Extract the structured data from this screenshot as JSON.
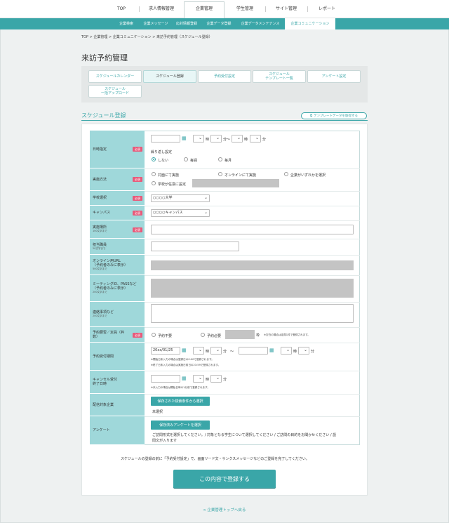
{
  "topnav": {
    "items": [
      "TOP",
      "求人情報管理",
      "企業管理",
      "学生管理",
      "サイト管理",
      "レポート"
    ]
  },
  "subnav": {
    "items": [
      "企業検索",
      "企業メッセージ",
      "応対情報登録",
      "企業データ登録",
      "企業データメンテナンス",
      "企業コミュニケーション"
    ]
  },
  "breadcrumb": "TOP > 企業管理 > 企業コミュニケーション > 来訪予約管理（スケジュール登録）",
  "page_title": "来訪予約管理",
  "tabs": {
    "calendar": "スケジュールカレンダー",
    "register": "スケジュール登録",
    "settings": "予約受付設定",
    "tpl1": "スケジュール",
    "tpl2": "テンプレート一覧",
    "survey": "アンケート設定",
    "bulk1": "スケジュール",
    "bulk2": "一括アップロード"
  },
  "section_title": "スケジュール登録",
  "template_button": "テンプレートデータを取得する",
  "labels": {
    "date": "日時指定",
    "method": "実施方法",
    "school": "学校選択",
    "campus": "キャンパス",
    "place": "実施場所",
    "place_note": "100文字まで",
    "staff": "担当職員",
    "staff_note": "20文字まで",
    "url1": "オンライン用URL",
    "url2": "（予約者のみに表示）",
    "url_note": "500文字まで",
    "mid1": "ミーティングID、PASSなど",
    "mid2": "（予約者のみに表示）",
    "mid_note": "200文字まで",
    "contact": "連絡事項など",
    "contact_note": "200文字まで",
    "need1": "予約要否／定員（枠",
    "need2": "数）",
    "period": "予約受付期間",
    "cancel1": "キャンセル受付",
    "cancel2": "終了日時",
    "target": "配信対象企業",
    "survey": "アンケート"
  },
  "required": "必須",
  "units": {
    "hour": "時",
    "min": "分",
    "range": "分〜",
    "tilde": "〜",
    "frame": "枠"
  },
  "repeat": {
    "title": "繰り返し設定",
    "none": "しない",
    "weekly": "毎週",
    "monthly": "毎月"
  },
  "method": {
    "face": "対面にて実施",
    "online": "オンラインにて実施",
    "either": "企業がいずれかを選択",
    "school": "学校が任意に設定"
  },
  "school_value": "○○○○大学",
  "campus_value": "○○○○キャンパス",
  "need": {
    "no": "予約不要",
    "yes": "予約必要",
    "note": "※空白の場合は定員1枠で登録されます。"
  },
  "period": {
    "start": "20xx/01/25",
    "note1": "※開始日未入力の場合は登録日の0:00で登録されます。",
    "note2": "※終了日未入力の場合は実施日前日の23:59で登録されます。"
  },
  "cancel_note": "※未入力の場合は開始日時の1分前で登録されます。",
  "target": {
    "button": "保存された検索条件から選択",
    "value": "未選択"
  },
  "survey": {
    "button": "保存済みアンケートを選択",
    "text1": "ご訪問形式を選択してください。/ 対象となる学生について選択してください / ご訪問の目的をお聞かせください / 設",
    "text2": "問文が入ります"
  },
  "notice": "スケジュールの登録の前に「予約受付設定」で、画面リード文・サンクスメッセージなどのご登録を完了してください。",
  "submit": "この内容で登録する",
  "back_link": "< 企業管理トップへ戻る"
}
